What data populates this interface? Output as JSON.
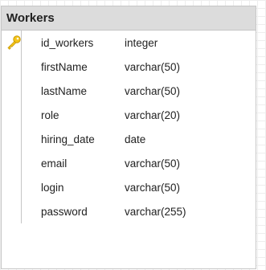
{
  "table": {
    "title": "Workers",
    "columns": [
      {
        "name": "id_workers",
        "type": "integer",
        "primary_key": true,
        "key_icon": "key-icon"
      },
      {
        "name": "firstName",
        "type": "varchar(50)",
        "primary_key": false
      },
      {
        "name": "lastName",
        "type": "varchar(50)",
        "primary_key": false
      },
      {
        "name": "role",
        "type": "varchar(20)",
        "primary_key": false
      },
      {
        "name": "hiring_date",
        "type": "date",
        "primary_key": false
      },
      {
        "name": "email",
        "type": "varchar(50)",
        "primary_key": false
      },
      {
        "name": "login",
        "type": "varchar(50)",
        "primary_key": false
      },
      {
        "name": "password",
        "type": "varchar(255)",
        "primary_key": false
      }
    ]
  },
  "colors": {
    "header_background": "#dcdcdc",
    "border": "#c6c6c6",
    "key_icon": "#f5c518"
  }
}
